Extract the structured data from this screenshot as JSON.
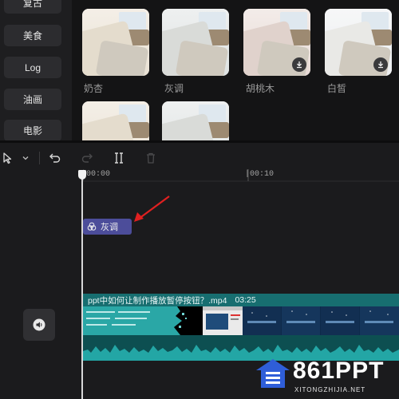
{
  "categories": [
    "复古",
    "美食",
    "Log",
    "油画",
    "电影"
  ],
  "filters": [
    {
      "name": "奶杏",
      "downloadable": false
    },
    {
      "name": "灰调",
      "downloadable": false
    },
    {
      "name": "胡桃木",
      "downloadable": true
    },
    {
      "name": "白皙",
      "downloadable": true
    },
    {
      "name": "",
      "downloadable": false
    },
    {
      "name": "",
      "downloadable": false
    }
  ],
  "timeline": {
    "ticks": [
      "00:00",
      "|00:10"
    ],
    "filter_clip_label": "灰调",
    "video_clip": {
      "title": "ppt中如何让制作播放暂停按钮？.mp4",
      "duration": "03:25"
    }
  },
  "watermark": {
    "brand": "861PPT",
    "url": "XITONGZHIJIA.NET"
  },
  "colors": {
    "accent_clip": "#4c4d9a",
    "video_clip": "#0f5d5e",
    "arrow": "#e02020"
  }
}
